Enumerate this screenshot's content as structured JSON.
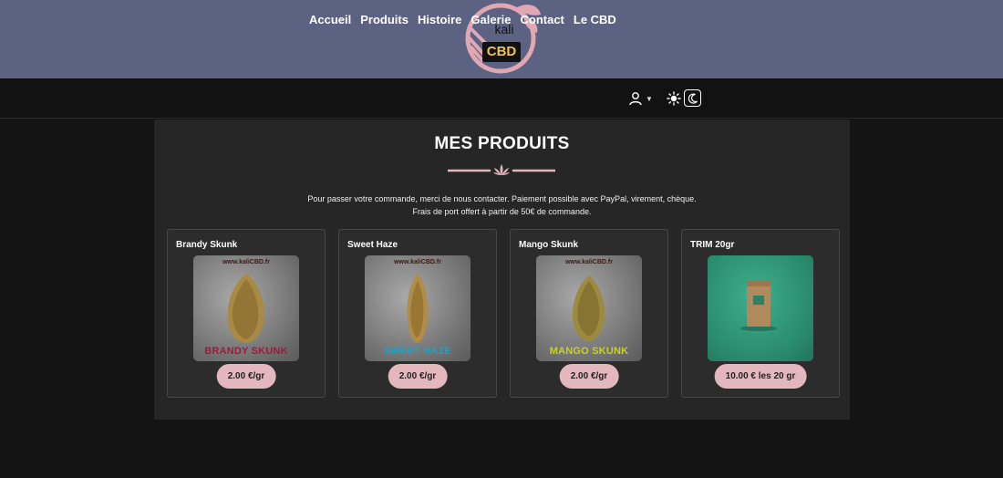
{
  "brand": {
    "logo_top": "kali",
    "logo_bottom": "CBD",
    "banner_color": "#5b6282",
    "logo_ring_color": "#e0a8b2",
    "logo_badge_text_color": "#f2c14e"
  },
  "nav": {
    "links": [
      "Accueil",
      "Produits",
      "Histoire",
      "Galerie",
      "Contact",
      "Le CBD"
    ],
    "user_icon": "user-icon",
    "theme_icons": [
      "sun-icon",
      "moon-icon"
    ]
  },
  "main": {
    "title": "MES PRODUITS",
    "intro_line1": "Pour passer votre commande, merci de nous contacter. Paiement possible avec PayPal, virement, chèque.",
    "intro_line2": "Frais de port offert à partir de 50€ de commande.",
    "accent_color": "#e4b6bd"
  },
  "products": [
    {
      "name": "Brandy Skunk",
      "image_url_text": "www.kaliCBD.fr",
      "image_label": "BRANDY SKUNK",
      "image_label_color": "#9e1a3e",
      "price": "2.00 €/gr"
    },
    {
      "name": "Sweet Haze",
      "image_url_text": "www.kaliCBD.fr",
      "image_label": "SWEET HAZE",
      "image_label_color": "#1aa3c7",
      "price": "2.00 €/gr"
    },
    {
      "name": "Mango Skunk",
      "image_url_text": "www.kaliCBD.fr",
      "image_label": "MANGO SKUNK",
      "image_label_color": "#c7d12a",
      "price": "2.00 €/gr"
    },
    {
      "name": "TRIM 20gr",
      "image_url_text": "",
      "image_label": "",
      "image_label_color": "",
      "price": "10.00 € les 20 gr"
    }
  ]
}
